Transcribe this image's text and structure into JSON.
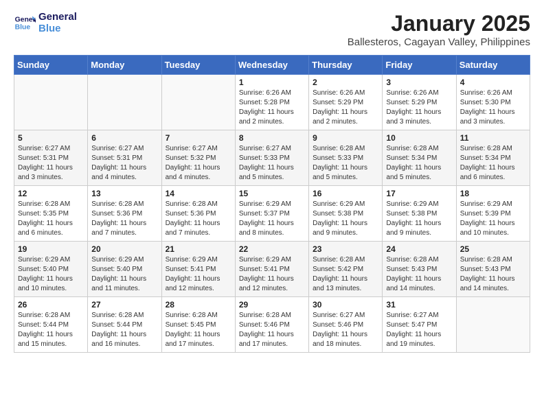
{
  "header": {
    "logo_line1": "General",
    "logo_line2": "Blue",
    "month_title": "January 2025",
    "subtitle": "Ballesteros, Cagayan Valley, Philippines"
  },
  "days_of_week": [
    "Sunday",
    "Monday",
    "Tuesday",
    "Wednesday",
    "Thursday",
    "Friday",
    "Saturday"
  ],
  "weeks": [
    [
      {
        "day": "",
        "info": ""
      },
      {
        "day": "",
        "info": ""
      },
      {
        "day": "",
        "info": ""
      },
      {
        "day": "1",
        "info": "Sunrise: 6:26 AM\nSunset: 5:28 PM\nDaylight: 11 hours\nand 2 minutes."
      },
      {
        "day": "2",
        "info": "Sunrise: 6:26 AM\nSunset: 5:29 PM\nDaylight: 11 hours\nand 2 minutes."
      },
      {
        "day": "3",
        "info": "Sunrise: 6:26 AM\nSunset: 5:29 PM\nDaylight: 11 hours\nand 3 minutes."
      },
      {
        "day": "4",
        "info": "Sunrise: 6:26 AM\nSunset: 5:30 PM\nDaylight: 11 hours\nand 3 minutes."
      }
    ],
    [
      {
        "day": "5",
        "info": "Sunrise: 6:27 AM\nSunset: 5:31 PM\nDaylight: 11 hours\nand 3 minutes."
      },
      {
        "day": "6",
        "info": "Sunrise: 6:27 AM\nSunset: 5:31 PM\nDaylight: 11 hours\nand 4 minutes."
      },
      {
        "day": "7",
        "info": "Sunrise: 6:27 AM\nSunset: 5:32 PM\nDaylight: 11 hours\nand 4 minutes."
      },
      {
        "day": "8",
        "info": "Sunrise: 6:27 AM\nSunset: 5:33 PM\nDaylight: 11 hours\nand 5 minutes."
      },
      {
        "day": "9",
        "info": "Sunrise: 6:28 AM\nSunset: 5:33 PM\nDaylight: 11 hours\nand 5 minutes."
      },
      {
        "day": "10",
        "info": "Sunrise: 6:28 AM\nSunset: 5:34 PM\nDaylight: 11 hours\nand 5 minutes."
      },
      {
        "day": "11",
        "info": "Sunrise: 6:28 AM\nSunset: 5:34 PM\nDaylight: 11 hours\nand 6 minutes."
      }
    ],
    [
      {
        "day": "12",
        "info": "Sunrise: 6:28 AM\nSunset: 5:35 PM\nDaylight: 11 hours\nand 6 minutes."
      },
      {
        "day": "13",
        "info": "Sunrise: 6:28 AM\nSunset: 5:36 PM\nDaylight: 11 hours\nand 7 minutes."
      },
      {
        "day": "14",
        "info": "Sunrise: 6:28 AM\nSunset: 5:36 PM\nDaylight: 11 hours\nand 7 minutes."
      },
      {
        "day": "15",
        "info": "Sunrise: 6:29 AM\nSunset: 5:37 PM\nDaylight: 11 hours\nand 8 minutes."
      },
      {
        "day": "16",
        "info": "Sunrise: 6:29 AM\nSunset: 5:38 PM\nDaylight: 11 hours\nand 9 minutes."
      },
      {
        "day": "17",
        "info": "Sunrise: 6:29 AM\nSunset: 5:38 PM\nDaylight: 11 hours\nand 9 minutes."
      },
      {
        "day": "18",
        "info": "Sunrise: 6:29 AM\nSunset: 5:39 PM\nDaylight: 11 hours\nand 10 minutes."
      }
    ],
    [
      {
        "day": "19",
        "info": "Sunrise: 6:29 AM\nSunset: 5:40 PM\nDaylight: 11 hours\nand 10 minutes."
      },
      {
        "day": "20",
        "info": "Sunrise: 6:29 AM\nSunset: 5:40 PM\nDaylight: 11 hours\nand 11 minutes."
      },
      {
        "day": "21",
        "info": "Sunrise: 6:29 AM\nSunset: 5:41 PM\nDaylight: 11 hours\nand 12 minutes."
      },
      {
        "day": "22",
        "info": "Sunrise: 6:29 AM\nSunset: 5:41 PM\nDaylight: 11 hours\nand 12 minutes."
      },
      {
        "day": "23",
        "info": "Sunrise: 6:28 AM\nSunset: 5:42 PM\nDaylight: 11 hours\nand 13 minutes."
      },
      {
        "day": "24",
        "info": "Sunrise: 6:28 AM\nSunset: 5:43 PM\nDaylight: 11 hours\nand 14 minutes."
      },
      {
        "day": "25",
        "info": "Sunrise: 6:28 AM\nSunset: 5:43 PM\nDaylight: 11 hours\nand 14 minutes."
      }
    ],
    [
      {
        "day": "26",
        "info": "Sunrise: 6:28 AM\nSunset: 5:44 PM\nDaylight: 11 hours\nand 15 minutes."
      },
      {
        "day": "27",
        "info": "Sunrise: 6:28 AM\nSunset: 5:44 PM\nDaylight: 11 hours\nand 16 minutes."
      },
      {
        "day": "28",
        "info": "Sunrise: 6:28 AM\nSunset: 5:45 PM\nDaylight: 11 hours\nand 17 minutes."
      },
      {
        "day": "29",
        "info": "Sunrise: 6:28 AM\nSunset: 5:46 PM\nDaylight: 11 hours\nand 17 minutes."
      },
      {
        "day": "30",
        "info": "Sunrise: 6:27 AM\nSunset: 5:46 PM\nDaylight: 11 hours\nand 18 minutes."
      },
      {
        "day": "31",
        "info": "Sunrise: 6:27 AM\nSunset: 5:47 PM\nDaylight: 11 hours\nand 19 minutes."
      },
      {
        "day": "",
        "info": ""
      }
    ]
  ]
}
